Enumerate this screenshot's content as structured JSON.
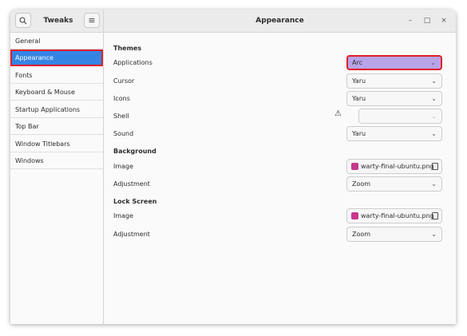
{
  "header": {
    "app_title": "Tweaks",
    "page_title": "Appearance",
    "minimize": "–",
    "maximize": "□",
    "close": "×",
    "menu_icon": "≡"
  },
  "sidebar": {
    "items": [
      {
        "label": "General"
      },
      {
        "label": "Appearance"
      },
      {
        "label": "Fonts"
      },
      {
        "label": "Keyboard & Mouse"
      },
      {
        "label": "Startup Applications"
      },
      {
        "label": "Top Bar"
      },
      {
        "label": "Window Titlebars"
      },
      {
        "label": "Windows"
      }
    ],
    "selected": "Appearance"
  },
  "themes": {
    "heading": "Themes",
    "applications": {
      "label": "Applications",
      "value": "Arc"
    },
    "cursor": {
      "label": "Cursor",
      "value": "Yaru"
    },
    "icons": {
      "label": "Icons",
      "value": "Yaru"
    },
    "shell": {
      "label": "Shell",
      "value": ""
    },
    "sound": {
      "label": "Sound",
      "value": "Yaru"
    }
  },
  "background": {
    "heading": "Background",
    "image": {
      "label": "Image",
      "value": "warty-final-ubuntu.png"
    },
    "adjustment": {
      "label": "Adjustment",
      "value": "Zoom"
    }
  },
  "lock_screen": {
    "heading": "Lock Screen",
    "image": {
      "label": "Image",
      "value": "warty-final-ubuntu.png"
    },
    "adjustment": {
      "label": "Adjustment",
      "value": "Zoom"
    }
  },
  "glyphs": {
    "chevron": "⌄",
    "warning": "⚠"
  },
  "colors": {
    "selection": "#3584e4",
    "highlight_combo": "#b8a4e8",
    "annotation_border": "#e0202a"
  }
}
